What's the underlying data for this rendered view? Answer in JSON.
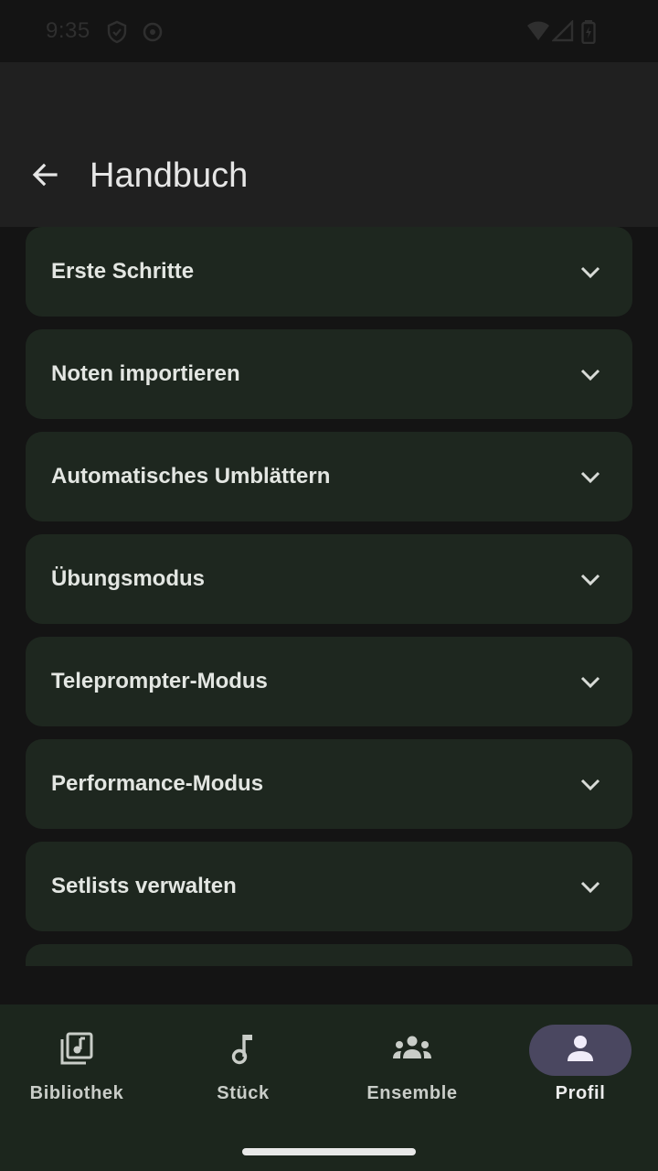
{
  "status_bar": {
    "time": "9:35"
  },
  "app_bar": {
    "title": "Handbuch"
  },
  "sections": [
    {
      "label": "Erste Schritte"
    },
    {
      "label": "Noten importieren"
    },
    {
      "label": "Automatisches Umblättern"
    },
    {
      "label": "Übungsmodus"
    },
    {
      "label": "Teleprompter-Modus"
    },
    {
      "label": "Performance-Modus"
    },
    {
      "label": "Setlists verwalten"
    },
    {
      "label": ""
    }
  ],
  "bottom_nav": {
    "items": [
      {
        "label": "Bibliothek",
        "icon": "library-music-icon",
        "active": false
      },
      {
        "label": "Stück",
        "icon": "music-note-icon",
        "active": false
      },
      {
        "label": "Ensemble",
        "icon": "groups-icon",
        "active": false
      },
      {
        "label": "Profil",
        "icon": "person-icon",
        "active": true
      }
    ]
  },
  "colors": {
    "background": "#141414",
    "app_bar": "#202020",
    "card": "#1e271f",
    "nav_background": "#1c261d",
    "nav_active_pill": "#4a4760"
  }
}
